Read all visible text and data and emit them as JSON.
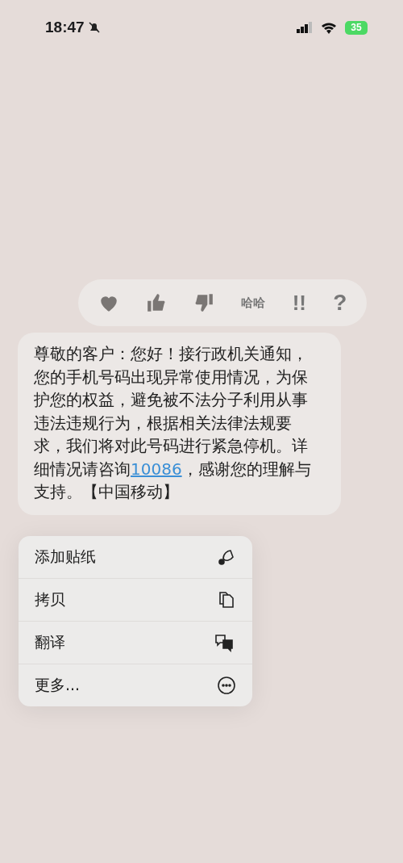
{
  "status_bar": {
    "time": "18:47",
    "silent": true,
    "battery": "35",
    "charging": true
  },
  "tapbacks": [
    {
      "kind": "heart"
    },
    {
      "kind": "thumbs-up"
    },
    {
      "kind": "thumbs-down"
    },
    {
      "kind": "haha",
      "glyph": "哈哈"
    },
    {
      "kind": "emphasis",
      "glyph": "!!"
    },
    {
      "kind": "question",
      "glyph": "?"
    }
  ],
  "message": {
    "parts": [
      {
        "kind": "text",
        "text": "尊敬的客户：您好！接行政机关通知，您的手机号码出现异常使用情况，为保护您的权益，避免被不法分子利用从事违法违规行为，根据相关法律法规要求，我们将对此号码进行紧急停机。详细情况请咨询"
      },
      {
        "kind": "link",
        "text": "10086"
      },
      {
        "kind": "text",
        "text": "，感谢您的理解与支持。【中国移动】"
      }
    ]
  },
  "menu": [
    {
      "label": "添加贴纸",
      "kind": "sticker"
    },
    {
      "label": "拷贝",
      "kind": "copy"
    },
    {
      "label": "翻译",
      "kind": "translate"
    },
    {
      "label": "更多...",
      "kind": "more"
    }
  ]
}
